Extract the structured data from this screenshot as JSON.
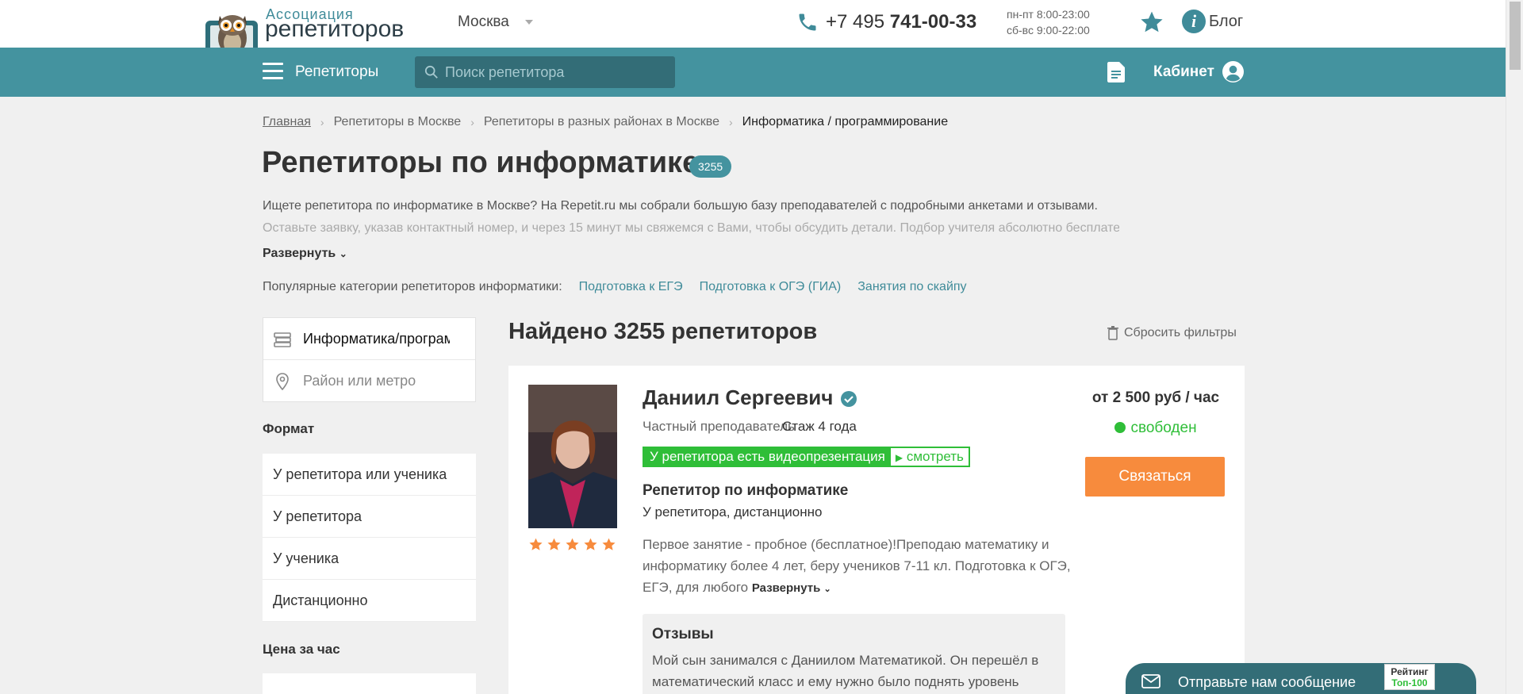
{
  "header": {
    "logo_line1": "Ассоциация",
    "logo_line2": "репетиторов",
    "city": "Москва",
    "phone_prefix": "+7 495",
    "phone_number": "741-00-33",
    "hours_weekdays": "пн-пт 8:00-23:00",
    "hours_weekend": "сб-вс 9:00-22:00",
    "blog_label": "Блог"
  },
  "nav": {
    "tutors_label": "Репетиторы",
    "search_placeholder": "Поиск репетитора",
    "cabinet_label": "Кабинет"
  },
  "breadcrumb": {
    "items": [
      "Главная",
      "Репетиторы в Москве",
      "Репетиторы в разных районах в Москве"
    ],
    "current": "Информатика / программирование"
  },
  "page": {
    "title": "Репетиторы по информатике",
    "count_badge": "3255",
    "intro_line1": "Ищете репетитора по информатике в Москве? На Repetit.ru мы собрали большую базу преподавателей с подробными анкетами и отзывами.",
    "intro_line2": "Оставьте заявку, указав контактный номер, и через 15 минут мы свяжемся с Вами, чтобы обсудить детали. Подбор учителя абсолютно бесплатен и занимает",
    "expand_label": "Развернуть",
    "popular_label": "Популярные категории репетиторов информатики:",
    "popular_links": [
      "Подготовка к ЕГЭ",
      "Подготовка к ОГЭ (ГИА)",
      "Занятия по скайпу"
    ]
  },
  "filters": {
    "subject_value": "Информатика/программирование",
    "location_placeholder": "Район или метро",
    "format_heading": "Формат",
    "format_options": [
      "У репетитора или ученика",
      "У репетитора",
      "У ученика",
      "Дистанционно"
    ],
    "price_heading": "Цена за час"
  },
  "results": {
    "found_text": "Найдено 3255 репетиторов",
    "reset_label": "Сбросить фильтры"
  },
  "tutor": {
    "name": "Даниил Сергеевич",
    "type": "Частный преподаватель",
    "experience": "Стаж 4 года",
    "video_label": "У репетитора есть видеопрезентация",
    "video_link": "смотреть",
    "subject": "Репетитор по информатике",
    "place": "У репетитора, дистанционно",
    "description": "Первое занятие - пробное (бесплатное)!Преподаю математику и информатику более 4 лет, беру учеников 7-11 кл. Подготовка к ОГЭ, ЕГЭ, для любого",
    "expand_label": "Развернуть",
    "stars": 5,
    "price": "от 2 500 руб / час",
    "status": "свободен",
    "contact_label": "Связаться",
    "reviews_heading": "Отзывы",
    "review_text": "Мой сын занимался с Даниилом Математикой. Он перешёл в математический класс и ему нужно было поднять уровень"
  },
  "widget": {
    "message_label": "Отправьте нам сообщение",
    "rating_line1": "Рейтинг",
    "rating_line2": "Топ-100"
  },
  "colors": {
    "teal": "#44939f",
    "teal_dark": "#336d77",
    "orange": "#f78b3d",
    "green": "#2fbe38",
    "star": "#f78b3d"
  }
}
